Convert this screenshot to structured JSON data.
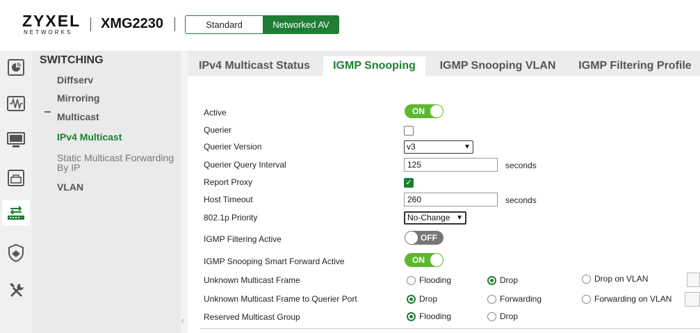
{
  "header": {
    "brand": "ZYXEL",
    "brand_sub": "NETWORKS",
    "model": "XMG2230",
    "modes": [
      "Standard",
      "Networked AV"
    ],
    "active_mode": "Networked AV",
    "accent_color": "#1e7e34"
  },
  "iconbar": [
    "dashboard-icon",
    "monitor-wave-icon",
    "display-icon",
    "network-box-icon",
    "switching-icon",
    "shield-icon",
    "tools-icon"
  ],
  "sidenav": {
    "section": "SWITCHING",
    "items": [
      "Diffserv",
      "Mirroring",
      "Multicast",
      "IPv4 Multicast",
      "Static Multicast Forwarding By IP",
      "VLAN"
    ],
    "active": "IPv4 Multicast"
  },
  "tabs": [
    "IPv4 Multicast Status",
    "IGMP Snooping",
    "IGMP Snooping VLAN",
    "IGMP Filtering Profile"
  ],
  "active_tab": "IGMP Snooping",
  "form": {
    "active_label": "Active",
    "active_state": "ON",
    "querier_label": "Querier",
    "querier_version_label": "Querier Version",
    "querier_version_value": "v3",
    "query_interval_label": "Querier Query Interval",
    "query_interval_value": "125",
    "query_interval_unit": "seconds",
    "report_proxy_label": "Report Proxy",
    "report_proxy_check": "✓",
    "host_timeout_label": "Host Timeout",
    "host_timeout_value": "260",
    "host_timeout_unit": "seconds",
    "priority_label": "802.1p Priority",
    "priority_value": "No-Change",
    "filtering_label": "IGMP Filtering Active",
    "filtering_state": "OFF",
    "smart_forward_label": "IGMP Snooping Smart Forward Active",
    "smart_forward_state": "ON",
    "unknown_frame_label": "Unknown Multicast Frame",
    "unknown_frame_options": [
      "Flooding",
      "Drop",
      "Drop on VLAN"
    ],
    "unknown_frame_selected": "Drop",
    "unknown_querier_label": "Unknown Multicast Frame to Querier Port",
    "unknown_querier_options": [
      "Drop",
      "Forwarding",
      "Forwarding on VLAN"
    ],
    "unknown_querier_selected": "Drop",
    "reserved_label": "Reserved Multicast Group",
    "reserved_options": [
      "Flooding",
      "Drop"
    ],
    "reserved_selected": "Flooding"
  }
}
